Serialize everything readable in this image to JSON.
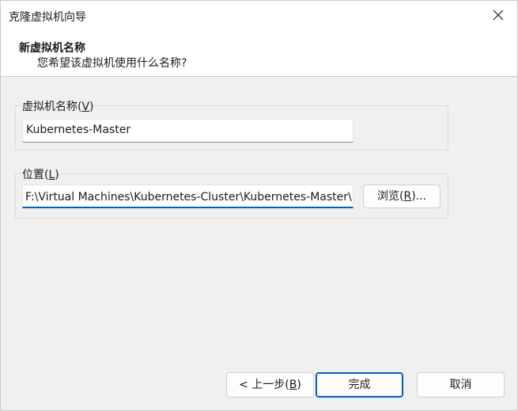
{
  "window": {
    "title": "克隆虚拟机向导"
  },
  "header": {
    "title": "新虚拟机名称",
    "subtitle": "您希望该虚拟机使用什么名称?"
  },
  "name_group": {
    "label_prefix": "虚拟机名称(",
    "label_key": "V",
    "label_suffix": ")",
    "value": "Kubernetes-Master"
  },
  "location_group": {
    "label_prefix": "位置(",
    "label_key": "L",
    "label_suffix": ")",
    "value": "F:\\Virtual Machines\\Kubernetes-Cluster\\Kubernetes-Master\\",
    "browse_prefix": "浏览(",
    "browse_key": "R",
    "browse_suffix": ")..."
  },
  "footer": {
    "back_prefix": "< 上一步(",
    "back_key": "B",
    "back_suffix": ")",
    "finish_label": "完成",
    "cancel_label": "取消"
  },
  "colors": {
    "accent": "#005fb8",
    "window_bg": "#f0f0f0",
    "header_bg": "#ffffff"
  },
  "icons": {
    "close": "close-icon"
  }
}
